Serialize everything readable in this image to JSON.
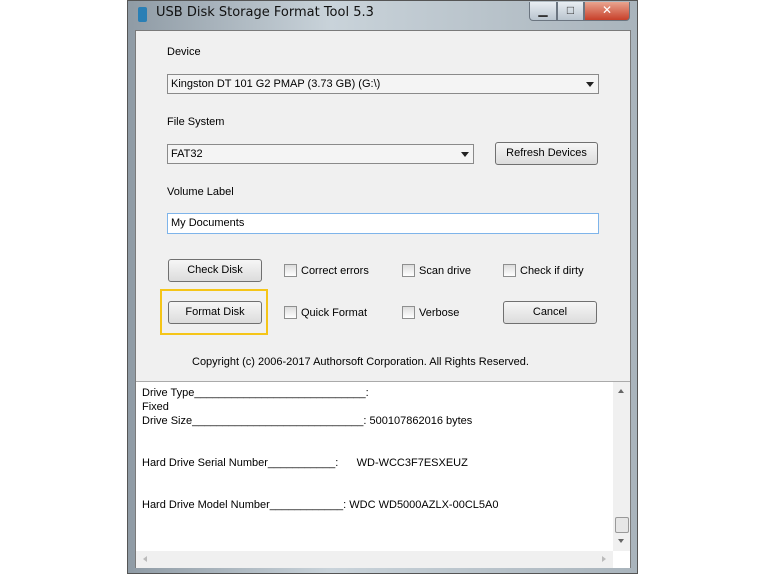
{
  "window": {
    "title": "USB Disk Storage Format Tool 5.3",
    "minimize": "▁",
    "maximize": "□",
    "close": "✕"
  },
  "device": {
    "label": "Device",
    "value": "Kingston  DT 101 G2  PMAP (3.73 GB) (G:\\)"
  },
  "filesystem": {
    "label": "File System",
    "value": "FAT32",
    "refresh": "Refresh Devices"
  },
  "volume": {
    "label": "Volume Label",
    "value": "My Documents"
  },
  "buttons": {
    "check": "Check Disk",
    "format": "Format Disk",
    "cancel": "Cancel"
  },
  "options": {
    "correct": "Correct errors",
    "scan": "Scan drive",
    "dirty": "Check if dirty",
    "quick": "Quick Format",
    "verbose": "Verbose"
  },
  "copyright": "Copyright (c) 2006-2017 Authorsoft Corporation. All Rights Reserved.",
  "log": [
    "Drive Type____________________________:",
    "Fixed",
    "Drive Size____________________________: 500107862016 bytes",
    "",
    "",
    "Hard Drive Serial Number___________:      WD-WCC3F7ESXEUZ",
    "",
    "",
    "Hard Drive Model Number____________: WDC WD5000AZLX-00CL5A0"
  ],
  "colors": {
    "highlight": "#f5c518"
  }
}
